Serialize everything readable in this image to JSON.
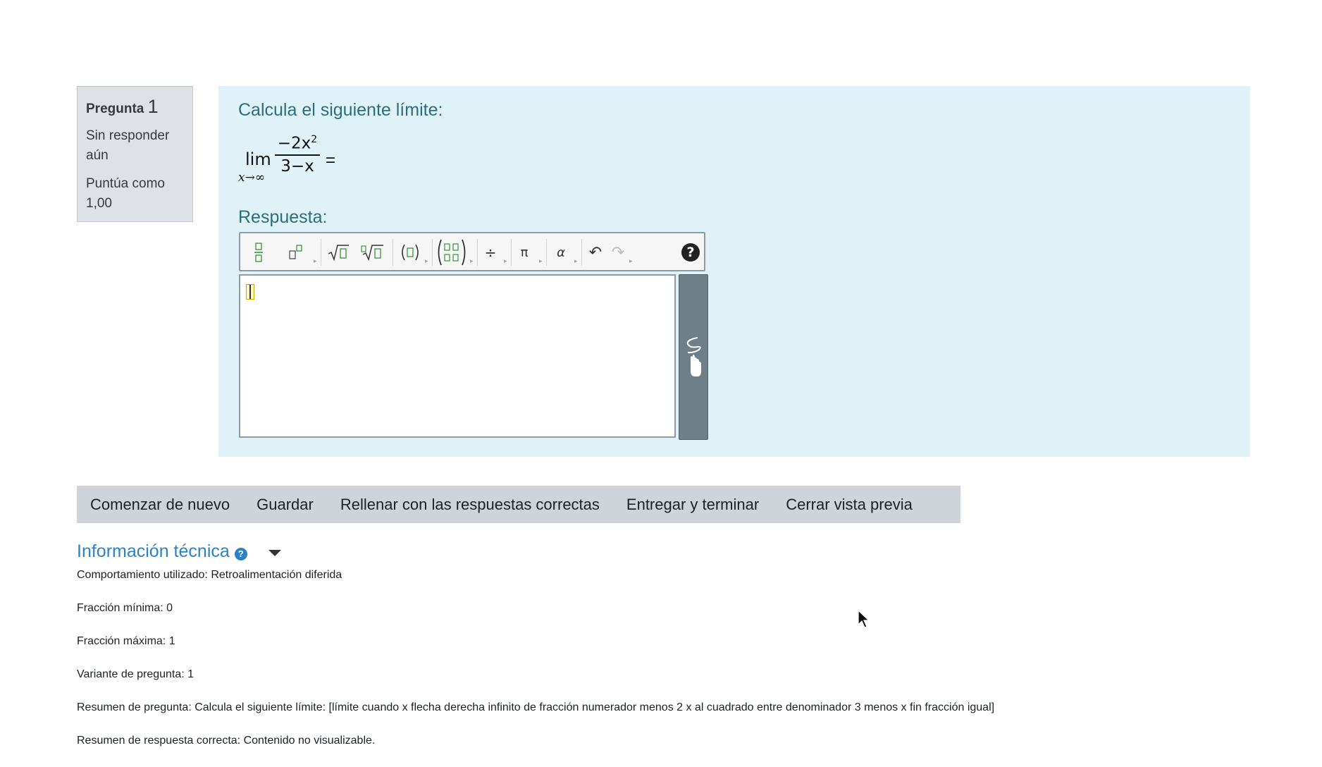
{
  "question_info": {
    "label": "Pregunta",
    "number": "1",
    "state": "Sin responder aún",
    "grade": "Puntúa como 1,00"
  },
  "question": {
    "text": "Calcula el siguiente límite:",
    "formula": {
      "lim": "lim",
      "subscript": "x→∞",
      "numerator": "−2x",
      "exponent": "2",
      "denominator": "3−x",
      "equals": "="
    },
    "answer_label": "Respuesta:"
  },
  "toolbar": {
    "buttons": [
      {
        "name": "fraction",
        "icon": "fraction-icon"
      },
      {
        "name": "superscript",
        "icon": "superscript-icon"
      },
      {
        "name": "square-root",
        "icon": "square-root-icon",
        "glyph": "√"
      },
      {
        "name": "nth-root",
        "icon": "nth-root-icon",
        "glyph": "√"
      },
      {
        "name": "parentheses",
        "icon": "parentheses-icon",
        "glyph": "(▯)"
      },
      {
        "name": "matrix",
        "icon": "matrix-icon"
      },
      {
        "name": "divide",
        "icon": "divide-icon",
        "glyph": "÷"
      },
      {
        "name": "pi",
        "icon": "pi-icon",
        "glyph": "π"
      },
      {
        "name": "alpha",
        "icon": "alpha-icon",
        "glyph": "α"
      },
      {
        "name": "undo",
        "icon": "undo-icon",
        "glyph": "↶"
      },
      {
        "name": "redo",
        "icon": "redo-icon",
        "glyph": "↷"
      }
    ],
    "help": "?"
  },
  "actions": {
    "restart": "Comenzar de nuevo",
    "save": "Guardar",
    "fill_correct": "Rellenar con las respuestas correctas",
    "submit": "Entregar y terminar",
    "close_preview": "Cerrar vista previa"
  },
  "tech_info": {
    "title": "Información técnica",
    "lines": [
      "Comportamiento utilizado: Retroalimentación diferida",
      "Fracción mínima: 0",
      "Fracción máxima: 1",
      "Variante de pregunta: 1",
      "Resumen de pregunta: Calcula el siguiente límite: [límite cuando x flecha derecha infinito de fracción numerador menos 2 x al cuadrado entre denominador 3 menos x fin fracción igual]",
      "Resumen de respuesta correcta: Contenido no visualizable."
    ]
  },
  "colors": {
    "question_bg": "#def2f8",
    "info_bg": "#dee2e6",
    "actions_bg": "#ced4da",
    "link": "#2d81c6",
    "heading_teal": "#2c6d7e"
  }
}
